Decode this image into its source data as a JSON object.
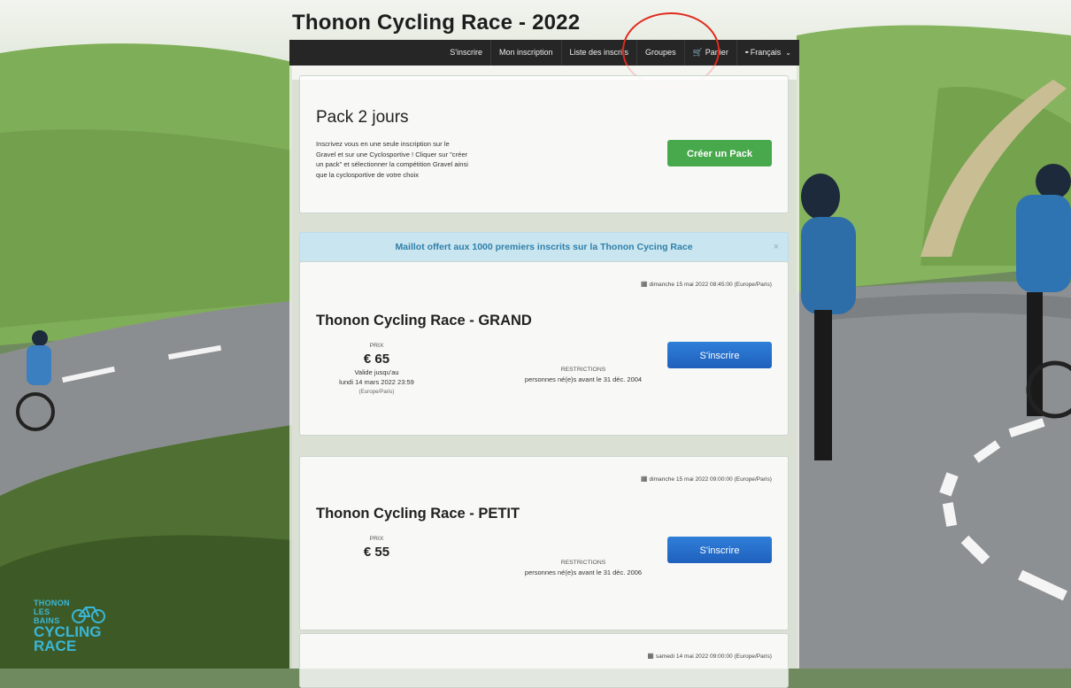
{
  "page": {
    "title": "Thonon Cycling Race - 2022"
  },
  "nav": {
    "items": [
      {
        "label": "S'inscrire",
        "name": "nav-sinscrire"
      },
      {
        "label": "Mon inscription",
        "name": "nav-mon-inscription"
      },
      {
        "label": "Liste des inscrits",
        "name": "nav-liste-des-inscrits"
      },
      {
        "label": "Groupes",
        "name": "nav-groupes"
      },
      {
        "label": "Panier",
        "name": "nav-panier"
      },
      {
        "label": "Français",
        "name": "nav-language"
      }
    ],
    "cart_icon": "cart-icon",
    "language_icon": "flag-icon"
  },
  "pack": {
    "title": "Pack 2 jours",
    "description": "Inscrivez vous en une seule inscription sur le Gravel et sur une Cyclosportive ! Cliquer sur \"créer un pack\" et sélectionner la compétition Gravel ainsi que la cyclosportive de votre choix",
    "button": "Créer un Pack"
  },
  "alert": {
    "text": "Maillot offert aux 1000 premiers inscrits sur la Thonon Cycing Race",
    "close": "×"
  },
  "races": [
    {
      "date": "dimanche 15 mai 2022 08:45:00 (Europe/Paris)",
      "title": "Thonon Cycling Race - GRAND",
      "price_label": "PRIX",
      "price": "€ 65",
      "valid_label": "Valide jusqu'au",
      "valid_date": "lundi 14 mars 2022 23:59",
      "timezone": "(Europe/Paris)",
      "restrictions_label": "RESTRICTIONS",
      "restrictions": "personnes né(e)s avant le 31 déc. 2004",
      "button": "S'inscrire"
    },
    {
      "date": "dimanche 15 mai 2022 09:00:00 (Europe/Paris)",
      "title": "Thonon Cycling Race - PETIT",
      "price_label": "PRIX",
      "price": "€ 55",
      "restrictions_label": "RESTRICTIONS",
      "restrictions": "personnes né(e)s avant le 31 déc. 2006",
      "button": "S'inscrire"
    },
    {
      "date": "samedi 14 mai 2022 09:00:00 (Europe/Paris)"
    }
  ],
  "logo": {
    "line1": "THONON",
    "line2": "LES",
    "line3": "BAINS",
    "line4": "CYCLING",
    "line5": "RACE"
  },
  "colors": {
    "nav_bg": "#262626",
    "green_button": "#47a84c",
    "blue_button": "#1f61bd",
    "alert_text": "#2f7fa9",
    "annotation": "#e02a1e",
    "logo": "#3ab6d8"
  }
}
